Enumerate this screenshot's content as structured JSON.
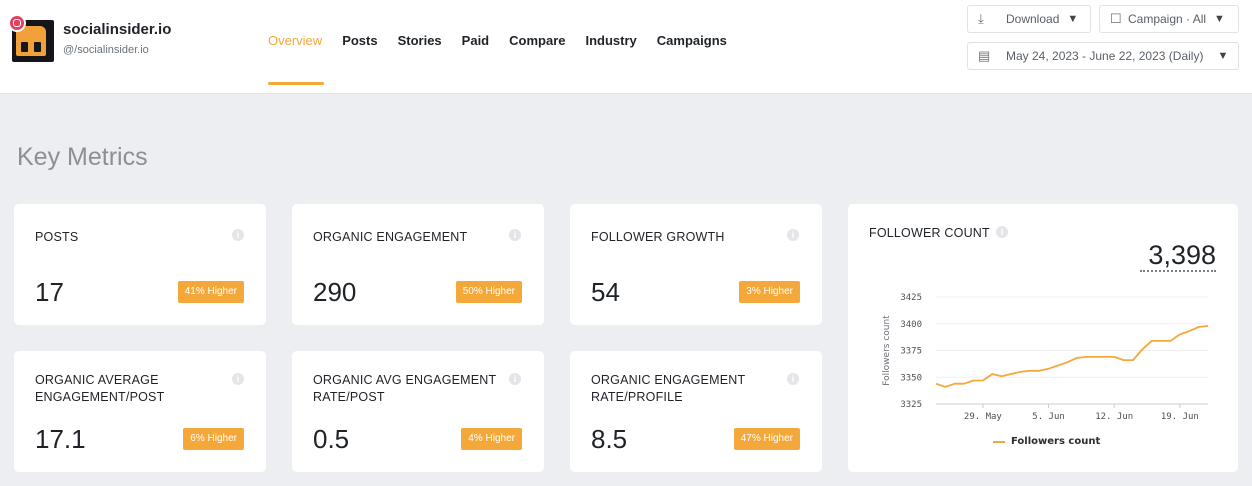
{
  "brand": {
    "name": "socialinsider.io",
    "handle": "@/socialinsider.io"
  },
  "nav": {
    "items": [
      "Overview",
      "Posts",
      "Stories",
      "Paid",
      "Compare",
      "Industry",
      "Campaigns"
    ],
    "active": "Overview"
  },
  "controls": {
    "download_label": "Download",
    "campaign_label": "Campaign · All",
    "date_range": "May 24, 2023 - June 22, 2023 (Daily)"
  },
  "section_title": "Key Metrics",
  "metrics": [
    {
      "label": "POSTS",
      "value": "17",
      "badge": "41% Higher"
    },
    {
      "label": "ORGANIC ENGAGEMENT",
      "value": "290",
      "badge": "50% Higher"
    },
    {
      "label": "FOLLOWER GROWTH",
      "value": "54",
      "badge": "3% Higher"
    },
    {
      "label": "ORGANIC AVERAGE ENGAGEMENT/POST",
      "label_lines": [
        "ORGANIC AVERAGE",
        "ENGAGEMENT/POST"
      ],
      "value": "17.1",
      "badge": "6% Higher"
    },
    {
      "label": "ORGANIC AVG ENGAGEMENT RATE/POST",
      "label_lines": [
        "ORGANIC AVG ENGAGEMENT",
        "RATE/POST"
      ],
      "value": "0.5",
      "badge": "4% Higher"
    },
    {
      "label": "ORGANIC ENGAGEMENT RATE/PROFILE",
      "label_lines": [
        "ORGANIC ENGAGEMENT",
        "RATE/PROFILE"
      ],
      "value": "8.5",
      "badge": "47% Higher"
    }
  ],
  "follower_count": {
    "title": "FOLLOWER COUNT",
    "value": "3,398"
  },
  "colors": {
    "accent": "#f5a83a",
    "instagram": "#e4405f"
  },
  "chart_data": {
    "type": "line",
    "ylabel": "Followers count",
    "ylim": [
      3325,
      3425
    ],
    "y_ticks": [
      3325,
      3350,
      3375,
      3400,
      3425
    ],
    "x_tick_labels": [
      "29. May",
      "5. Jun",
      "12. Jun",
      "19. Jun"
    ],
    "x_tick_days": [
      5,
      12,
      19,
      26
    ],
    "x_range_days": [
      0,
      29
    ],
    "series": [
      {
        "name": "Followers count",
        "days": [
          0,
          1,
          2,
          3,
          4,
          5,
          6,
          7,
          8,
          9,
          10,
          11,
          12,
          13,
          14,
          15,
          16,
          17,
          18,
          19,
          20,
          21,
          22,
          23,
          24,
          25,
          26,
          27,
          28,
          29
        ],
        "values": [
          3344,
          3341,
          3344,
          3344,
          3347,
          3347,
          3353,
          3351,
          3353,
          3355,
          3356,
          3356,
          3358,
          3361,
          3364,
          3368,
          3369,
          3369,
          3369,
          3369,
          3366,
          3366,
          3376,
          3384,
          3384,
          3384,
          3390,
          3393,
          3397,
          3398
        ]
      }
    ]
  }
}
